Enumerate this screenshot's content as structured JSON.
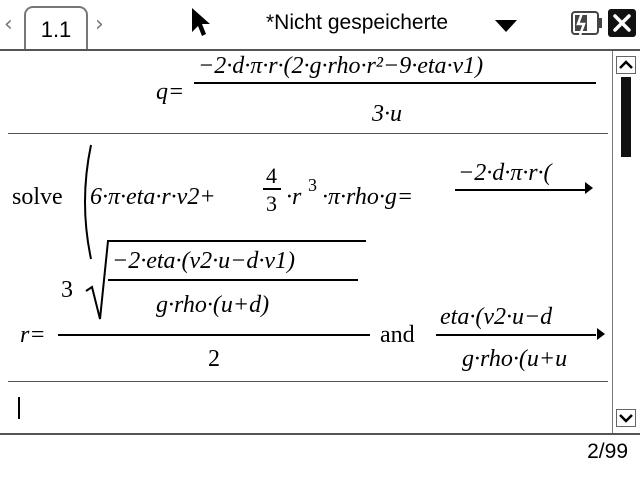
{
  "tab": {
    "label": "1.1"
  },
  "document": {
    "title": "*Nicht gespeicherte"
  },
  "history": {
    "entry1": {
      "lhs": "q=",
      "numerator": "−2·d·π·r·(2·g·rho·r²−9·eta·v1)",
      "denominator": "3·u"
    },
    "entry2": {
      "command": "solve",
      "input": "6·π·eta·r·v2+4/3·r³·π·rho·g=−2·d·π·r·(",
      "frac_num": "4",
      "frac_den": "3",
      "rhs_start": "−2·d·π·r·(",
      "result": {
        "lhs": "r=",
        "root_index": "3",
        "root_num": "−2·eta·(v2·u−d·v1)",
        "root_den": "g·rho·(u+d)",
        "outer_den": "2",
        "conjunction": "and",
        "second_num": "eta·(v2·u−d",
        "second_den": "g·rho·(u+u"
      }
    }
  },
  "status": {
    "page_counter": "2/99"
  },
  "icons": {
    "back": "chevron-left-icon",
    "forward": "chevron-right-icon",
    "pointer": "mouse-pointer-icon",
    "doc_menu": "caret-down-icon",
    "battery": "battery-icon",
    "close": "close-icon"
  }
}
